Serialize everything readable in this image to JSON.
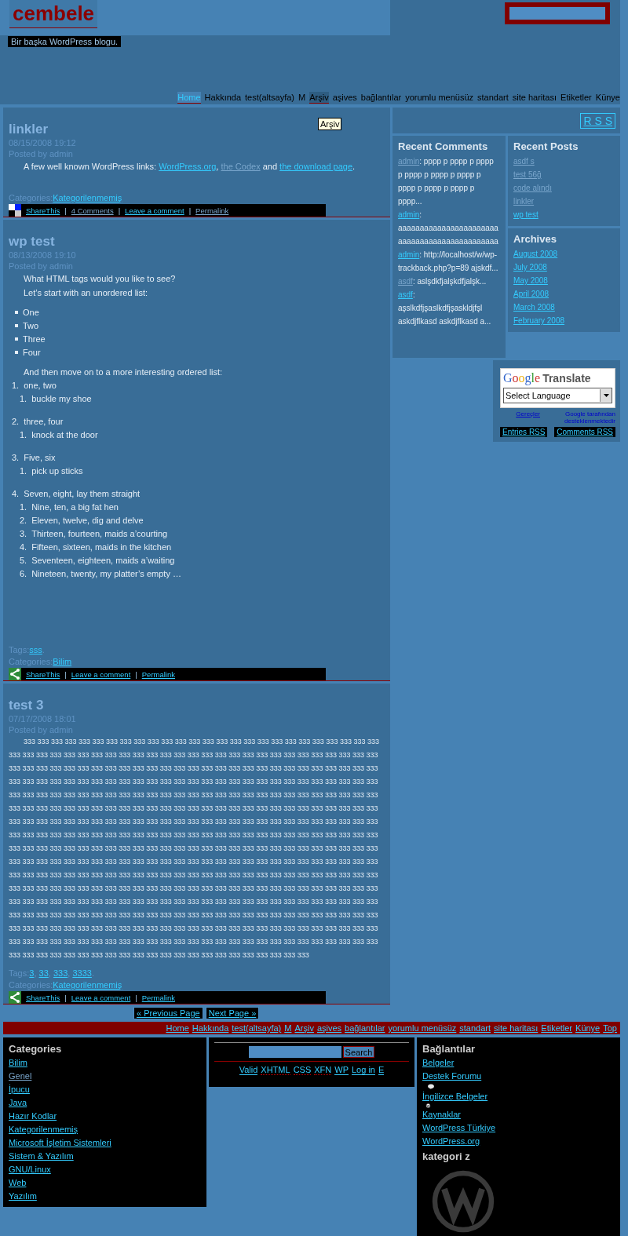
{
  "header": {
    "title": "cembele",
    "tagline": "Bir başka WordPress blogu."
  },
  "nav": [
    {
      "label": "Home",
      "selected": true,
      "hovered": false
    },
    {
      "label": "Hakkında",
      "selected": false,
      "hovered": false
    },
    {
      "label": "test(altsayfa)",
      "selected": false,
      "hovered": false
    },
    {
      "label": "M",
      "selected": false,
      "hovered": false
    },
    {
      "label": "Arşiv",
      "selected": false,
      "hovered": true
    },
    {
      "label": "aşives",
      "selected": false,
      "hovered": false
    },
    {
      "label": "bağlantılar",
      "selected": false,
      "hovered": false
    },
    {
      "label": "yorumlu menüsüz",
      "selected": false,
      "hovered": false
    },
    {
      "label": "standart",
      "selected": false,
      "hovered": false
    },
    {
      "label": "site haritası",
      "selected": false,
      "hovered": false
    },
    {
      "label": "Etiketler",
      "selected": false,
      "hovered": false
    },
    {
      "label": "Künye",
      "selected": false,
      "hovered": false
    }
  ],
  "tooltip": "Arşiv",
  "posts": [
    {
      "title": "linkler",
      "date": "08/15/2008 19:12",
      "author": "Posted by admin",
      "share": {
        "kind": "blocks"
      },
      "body": [
        {
          "kind": "paragraph",
          "segments": [
            {
              "text": "A few well known WordPress links: "
            },
            {
              "text": "WordPress.org",
              "link": true,
              "visited": false
            },
            {
              "text": ", "
            },
            {
              "text": "the Codex",
              "link": true,
              "visited": true
            },
            {
              "text": " and "
            },
            {
              "text": "the download page",
              "link": true,
              "visited": false
            },
            {
              "text": "."
            }
          ]
        }
      ],
      "meta": [
        [
          {
            "text": "Categories:"
          },
          {
            "text": "Kategorilenmemiş",
            "link": true,
            "visited": false
          }
        ]
      ],
      "actions": [
        {
          "text": "ShareThis",
          "kind": "link",
          "visited": false
        },
        {
          "text": "|",
          "kind": "separator"
        },
        {
          "text": "4 Comments",
          "kind": "link",
          "visited": true
        },
        {
          "text": "|",
          "kind": "separator"
        },
        {
          "text": "Leave a comment",
          "kind": "link",
          "visited": false
        },
        {
          "text": "|",
          "kind": "separator"
        },
        {
          "text": "Permalink",
          "kind": "link",
          "visited": true
        }
      ]
    },
    {
      "title": "wp test",
      "date": "08/13/2008 19:10",
      "author": "Posted by admin",
      "share": {
        "kind": "green"
      },
      "body": [
        {
          "kind": "paragraph",
          "segments": [
            {
              "text": "What HTML tags would you like to see?"
            }
          ]
        },
        {
          "kind": "paragraph",
          "segments": [
            {
              "text": "Let’s start with an unordered list:"
            }
          ]
        },
        {
          "kind": "bullets",
          "items": [
            "One",
            "Two",
            "Three",
            "Four"
          ]
        },
        {
          "kind": "paragraph",
          "segments": [
            {
              "text": "And then move on to a more interesting ordered list:"
            }
          ]
        },
        {
          "kind": "ordered",
          "items": [
            {
              "number": "1.",
              "text": "one, two",
              "children": [
                {
                  "number": "1.",
                  "text": "buckle my shoe"
                }
              ]
            },
            {
              "number": "2.",
              "text": "three, four",
              "children": [
                {
                  "number": "1.",
                  "text": "knock at the door"
                }
              ]
            },
            {
              "number": "3.",
              "text": "Five, six",
              "children": [
                {
                  "number": "1.",
                  "text": "pick up sticks"
                }
              ]
            },
            {
              "number": "4.",
              "text": "Seven, eight, lay them straight",
              "children": [
                {
                  "number": "1.",
                  "text": "Nine, ten, a big fat hen"
                },
                {
                  "number": "2.",
                  "text": "Eleven, twelve, dig and delve"
                },
                {
                  "number": "3.",
                  "text": "Thirteen, fourteen, maids a’courting"
                },
                {
                  "number": "4.",
                  "text": "Fifteen, sixteen, maids in the kitchen"
                },
                {
                  "number": "5.",
                  "text": "Seventeen, eighteen, maids a’waiting"
                },
                {
                  "number": "6.",
                  "text": "Nineteen, twenty, my platter’s empty …"
                }
              ]
            }
          ]
        }
      ],
      "meta": [
        [
          {
            "text": "Tags:"
          },
          {
            "text": "sss",
            "link": true,
            "visited": false
          },
          {
            "text": "."
          }
        ],
        [
          {
            "text": "Categories:"
          },
          {
            "text": "Bilim",
            "link": true,
            "visited": false
          }
        ]
      ],
      "actions": [
        {
          "text": "ShareThis",
          "kind": "link",
          "visited": false
        },
        {
          "text": "|",
          "kind": "separator"
        },
        {
          "text": "Leave a comment",
          "kind": "link",
          "visited": false
        },
        {
          "text": "|",
          "kind": "separator"
        },
        {
          "text": "Permalink",
          "kind": "link",
          "visited": false
        }
      ]
    },
    {
      "title": "test 3",
      "date": "07/17/2008 18:01",
      "author": "Posted by admin",
      "share": {
        "kind": "green"
      },
      "body": [
        {
          "kind": "paragraph",
          "segments": [
            {
              "text": "333 333 333 333 333 333 333 333 333 333 333 333 333 333 333 333 333 333 333 333 333 333 333 333 333 333 333 333 333 333 333 333 333 333 333 333 333 333 333 333 333 333 333 333 333 333 333 333 333 333 333 333 333 333 333 333 333 333 333 333 333 333 333 333 333 333 333 333 333 333 333 333 333 333 333 333 333 333 333 333 333 333 333 333 333 333 333 333 333 333 333 333 333 333 333 333 333 333 333 333 333 333 333 333 333 333 333 333 333 333 333 333 333 333 333 333 333 333 333 333 333 333 333 333 333 333 333 333 333 333 333 333 333 333 333 333 333 333 333 333 333 333 333 333 333 333 333 333 333 333 333 333 333 333 333 333 333 333 333 333 333 333 333 333 333 333 333 333 333 333 333 333 333 333 333 333 333 333 333 333 333 333 333 333 333 333 333 333 333 333 333 333 333 333 333 333 333 333 333 333 333 333 333 333 333 333 333 333 333 333 333 333 333 333 333 333 333 333 333 333 333 333 333 333 333 333 333 333 333 333 333 333 333 333 333 333 333 333 333 333 333 333 333 333 333 333 333 333 333 333 333 333 333 333 333 333 333 333 333 333 333 333 333 333 333 333 333 333 333 333 333 333 333 333 333 333 333 333 333 333 333 333 333 333 333 333 333 333 333 333 333 333 333 333 333 333 333 333 333 333 333 333 333 333 333 333 333 333 333 333 333 333 333 333 333 333 333 333 333 333 333 333 333 333 333 333 333 333 333 333 333 333 333 333 333 333 333 333 333 333 333 333 333 333 333 333 333 333 333 333 333 333 333 333 333 333 333 333 333 333 333 333 333 333 333 333 333 333 333 333 333 333 333 333 333 333 333 333 333 333 333 333 333 333 333 333 333 333 333 333 333 333 333 333 333 333 333 333 333 333 333 333 333 333 333 333 333 333 333 333 333 333 333 333 333 333 333 333 333 333 333 333 333 333 333 333 333 333 333 333 333 333 333 333 333 333 333 333 333 333 333 333 333 333 333 333 333 333 333 333 333 333 333"
            }
          ]
        }
      ],
      "meta": [
        [
          {
            "text": "Tags:"
          },
          {
            "text": "3",
            "link": true,
            "visited": false
          },
          {
            "text": ", "
          },
          {
            "text": "33",
            "link": true,
            "visited": false
          },
          {
            "text": ", "
          },
          {
            "text": "333",
            "link": true,
            "visited": false
          },
          {
            "text": ", "
          },
          {
            "text": "3333",
            "link": true,
            "visited": false
          },
          {
            "text": "."
          }
        ],
        [
          {
            "text": "Categories:"
          },
          {
            "text": "Kategorilenmemiş",
            "link": true,
            "visited": false
          }
        ]
      ],
      "actions": [
        {
          "text": "ShareThis",
          "kind": "link",
          "visited": false
        },
        {
          "text": "|",
          "kind": "separator"
        },
        {
          "text": "Leave a comment",
          "kind": "link",
          "visited": false
        },
        {
          "text": "|",
          "kind": "separator"
        },
        {
          "text": "Permalink",
          "kind": "link",
          "visited": false
        }
      ]
    }
  ],
  "sidebar": {
    "rss": "R S S",
    "recent_comments": {
      "title": "Recent Comments",
      "items": [
        {
          "author": "admin",
          "visited": true,
          "text": ": pppp p pppp p pppp p pppp p pppp p pppp p pppp p pppp p pppp p pppp..."
        },
        {
          "author": "admin",
          "visited": false,
          "text": ": aaaaaaaaaaaaaaaaaaaaaaa aaaaaaaaaaaaaaaaaaaaaaa"
        },
        {
          "author": "admin",
          "visited": false,
          "text": ": http://localhost/w/wp-trackback.php?p=89 ajskdf..."
        },
        {
          "author": "asdf",
          "visited": true,
          "text": ": aslşdkfjalşkdfjalşk..."
        },
        {
          "author": "asdf",
          "visited": false,
          "text": ": aşslkdfjşaslkdfjşaskldjfşl askdjflkasd askdjflkasd a..."
        }
      ]
    },
    "recent_posts": {
      "title": "Recent Posts",
      "items": [
        {
          "text": "asdf s",
          "visited": true
        },
        {
          "text": "test 56ğ",
          "visited": true
        },
        {
          "text": "code alındı",
          "visited": true
        },
        {
          "text": "linkler",
          "visited": true
        },
        {
          "text": "wp test",
          "visited": false
        }
      ]
    },
    "archives": {
      "title": "Archives",
      "items": [
        {
          "text": "August 2008",
          "visited": false
        },
        {
          "text": "July 2008",
          "visited": false
        },
        {
          "text": "May 2008",
          "visited": false
        },
        {
          "text": "April 2008",
          "visited": false
        },
        {
          "text": "March 2008",
          "visited": false
        },
        {
          "text": "February 2008",
          "visited": false
        }
      ]
    },
    "translate": {
      "logo": "Google",
      "label": "Translate",
      "select": "Select Language",
      "tools": "Gereçler",
      "powered": "Google tarafından desteklenmektedir"
    },
    "feeds": [
      "Entries RSS",
      "Comments RSS"
    ]
  },
  "pagination": [
    "« Previous Page",
    "Next Page »"
  ],
  "footer_nav": [
    "Home",
    "Hakkında",
    "test(altsayfa)",
    "M",
    "Arşiv",
    "aşives",
    "bağlantılar",
    "yorumlu menüsüz",
    "standart",
    "site haritası",
    "Etiketler",
    "Künye",
    "Top"
  ],
  "footer": {
    "categories": {
      "title": "Categories",
      "items": [
        {
          "text": "Bilim",
          "visited": false
        },
        {
          "text": "Genel",
          "visited": true
        },
        {
          "text": "İpucu",
          "visited": false
        },
        {
          "text": "Java",
          "visited": false
        },
        {
          "text": "Hazır Kodlar",
          "visited": false
        },
        {
          "text": "Kategorilenmemiş",
          "visited": false
        },
        {
          "text": "Microsoft İşletim Sistemleri",
          "visited": false
        },
        {
          "text": "Sistem & Yazılım",
          "visited": false
        },
        {
          "text": "GNU/Linux",
          "visited": false
        },
        {
          "text": "Web",
          "visited": false
        },
        {
          "text": "Yazılım",
          "visited": false
        }
      ]
    },
    "search_button": "Search",
    "links": [
      {
        "text": "Valid",
        "abbr": false
      },
      {
        "text": "XHTML",
        "abbr": true
      },
      {
        "text": "CSS",
        "abbr": true
      },
      {
        "text": "XFN",
        "abbr": true
      },
      {
        "text": "WP",
        "abbr": false
      },
      {
        "text": "Log in",
        "abbr": false
      },
      {
        "text": "E",
        "abbr": false
      }
    ],
    "blogroll": {
      "title": "Bağlantılar",
      "items": [
        {
          "kind": "link",
          "text": "Belgeler"
        },
        {
          "kind": "link",
          "text": "Destek Forumu"
        },
        {
          "kind": "speech"
        },
        {
          "kind": "link",
          "text": "İngilizce Belgeler"
        },
        {
          "kind": "wp"
        },
        {
          "kind": "link",
          "text": "Kaynaklar"
        },
        {
          "kind": "link",
          "text": "WordPress Türkiye"
        },
        {
          "kind": "link",
          "text": "WordPress.org"
        }
      ]
    },
    "category_z": "kategori z"
  }
}
